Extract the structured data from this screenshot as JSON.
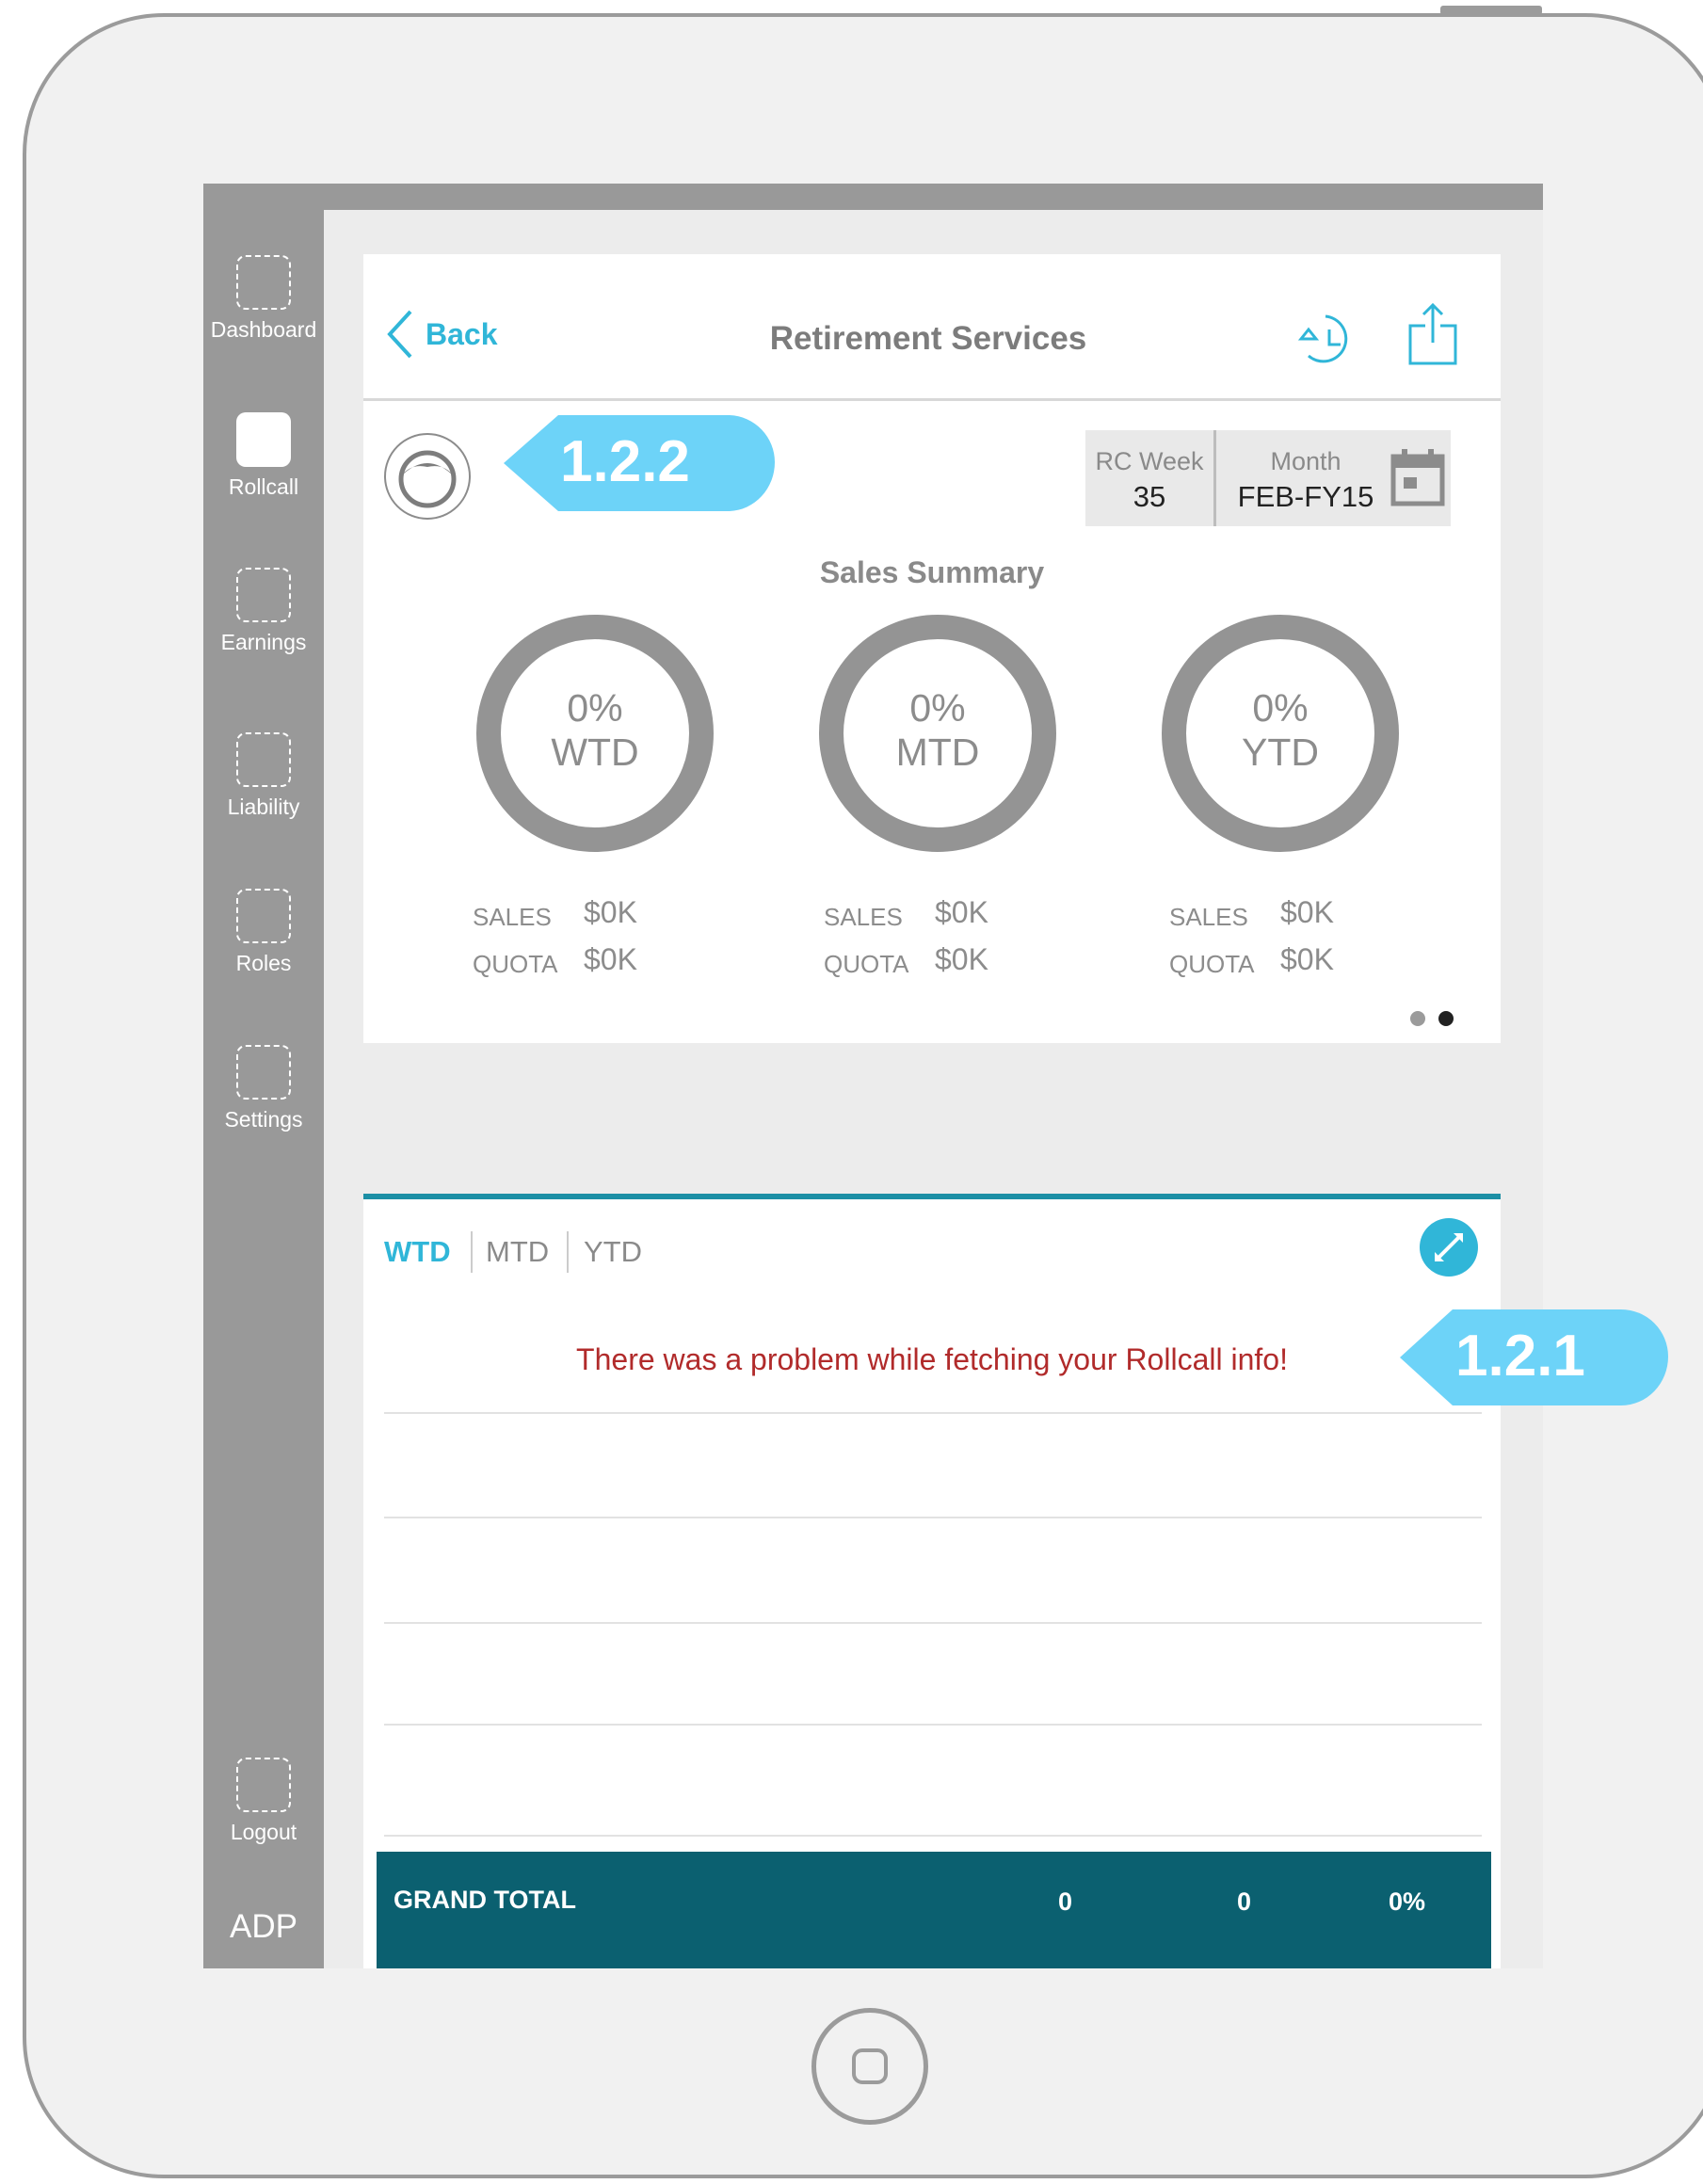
{
  "app": {
    "title": "Retirement Services",
    "back_label": "Back"
  },
  "sidebar": {
    "items": [
      {
        "label": "Dashboard",
        "active": false
      },
      {
        "label": "Rollcall",
        "active": true
      },
      {
        "label": "Earnings",
        "active": false
      },
      {
        "label": "Liability",
        "active": false
      },
      {
        "label": "Roles",
        "active": false
      },
      {
        "label": "Settings",
        "active": false
      }
    ],
    "logout_label": "Logout",
    "logo_text": "ADP"
  },
  "period": {
    "week_label": "RC Week",
    "week_value": "35",
    "month_label": "Month",
    "month_value": "FEB-FY15"
  },
  "summary": {
    "title": "Sales Summary",
    "rings": [
      {
        "percent": "0%",
        "period": "WTD",
        "sales_label": "SALES",
        "sales_value": "$0K",
        "quota_label": "QUOTA",
        "quota_value": "$0K"
      },
      {
        "percent": "0%",
        "period": "MTD",
        "sales_label": "SALES",
        "sales_value": "$0K",
        "quota_label": "QUOTA",
        "quota_value": "$0K"
      },
      {
        "percent": "0%",
        "period": "YTD",
        "sales_label": "SALES",
        "sales_value": "$0K",
        "quota_label": "QUOTA",
        "quota_value": "$0K"
      }
    ],
    "pager": {
      "pages": 2,
      "current_page": 2
    }
  },
  "annotations": {
    "callout_top": "1.2.2",
    "callout_error": "1.2.1"
  },
  "details": {
    "tabs": [
      "WTD",
      "MTD",
      "YTD"
    ],
    "active_tab": "WTD",
    "error_message": "There was a problem while fetching your Rollcall info!",
    "grand_total": {
      "label": "GRAND TOTAL",
      "values": [
        "0",
        "0",
        "0%"
      ]
    }
  },
  "colors": {
    "accent": "#30b6d8",
    "sidebar": "#999999",
    "error": "#b12b2b",
    "total_bar": "#0b6070",
    "callout": "#6dd3f8",
    "ring": "#949494"
  },
  "icons": {
    "back": "chevron-left-icon",
    "history": "history-icon",
    "share": "share-icon",
    "calendar": "calendar-icon",
    "expand": "expand-icon",
    "avatar": "user-avatar-icon"
  }
}
